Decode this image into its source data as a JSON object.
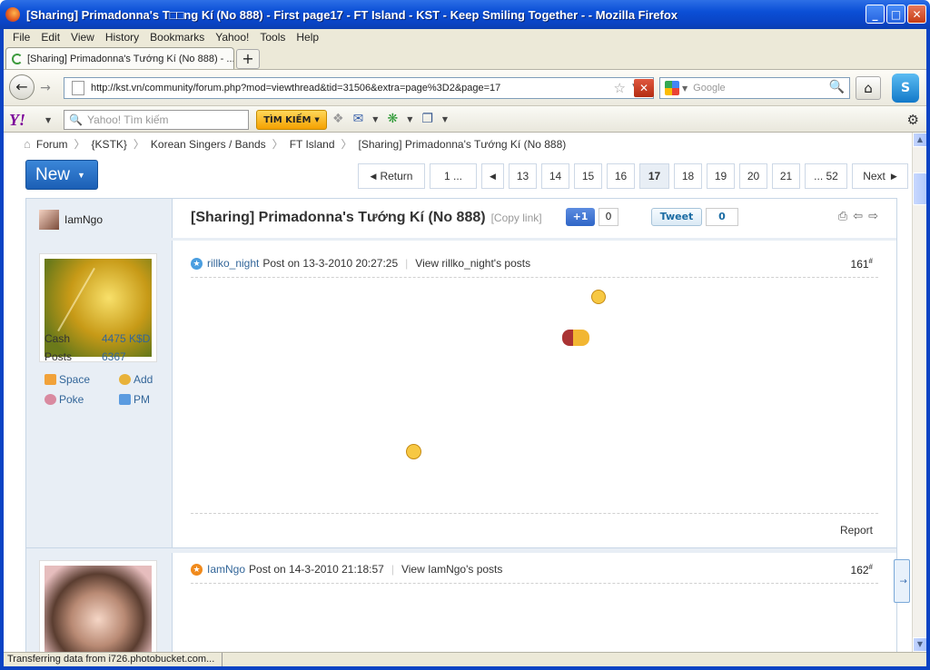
{
  "window": {
    "title": "[Sharing] Primadonna's T□□ng Kí (No 888) - First page17 - FT Island - KST - Keep Smiling Together - - Mozilla Firefox",
    "btn_min": "_",
    "btn_max": "□",
    "btn_close": "✕"
  },
  "menu": [
    "File",
    "Edit",
    "View",
    "History",
    "Bookmarks",
    "Yahoo!",
    "Tools",
    "Help"
  ],
  "tab": {
    "label": "[Sharing] Primadonna's Tướng Kí (No 888) - ...",
    "new_tab": "+"
  },
  "nav": {
    "url": "http://kst.vn/community/forum.php?mod=viewthread&tid=31506&extra=page%3D2&page=17",
    "search_placeholder": "Google",
    "stop": "✕"
  },
  "yahoo": {
    "logo": "Y!",
    "search_placeholder": "Yahoo! Tìm kiếm",
    "search_button": "TÌM KIẾM"
  },
  "breadcrumb": [
    "Forum",
    "{KSTK}",
    "Korean Singers / Bands",
    "FT Island",
    "[Sharing] Primadonna's Tướng Kí (No 888)"
  ],
  "new_button": "New",
  "pager": {
    "return": "Return",
    "first": "1 ...",
    "prev": "◀",
    "pages": [
      "13",
      "14",
      "15",
      "16",
      "17",
      "18",
      "19",
      "20",
      "21"
    ],
    "current": "17",
    "last": "... 52",
    "next": "Next"
  },
  "thread": {
    "author": "IamNgo",
    "title": "[Sharing] Primadonna's Tướng Kí (No 888)",
    "copy_link": "[Copy link]",
    "plus_one": "+1",
    "plus_one_count": "0",
    "tweet": "Tweet",
    "tweet_count": "0"
  },
  "posts": [
    {
      "user": "rillko_night",
      "time": "Post on 13-3-2010 20:27:25",
      "view": "View rillko_night's posts",
      "number": "161",
      "report": "Report",
      "badge_color": "#4a9ee0"
    },
    {
      "user": "IamNgo",
      "time": "Post on 14-3-2010 21:18:57",
      "view": "View IamNgo's posts",
      "number": "162",
      "badge_color": "#f08a1c"
    }
  ],
  "profile": {
    "cash_label": "Cash",
    "cash_value": "4475 K$D",
    "posts_label": "Posts",
    "posts_value": "6367",
    "space": "Space",
    "add": "Add",
    "poke": "Poke",
    "pm": "PM"
  },
  "status": "Transferring data from i726.photobucket.com..."
}
